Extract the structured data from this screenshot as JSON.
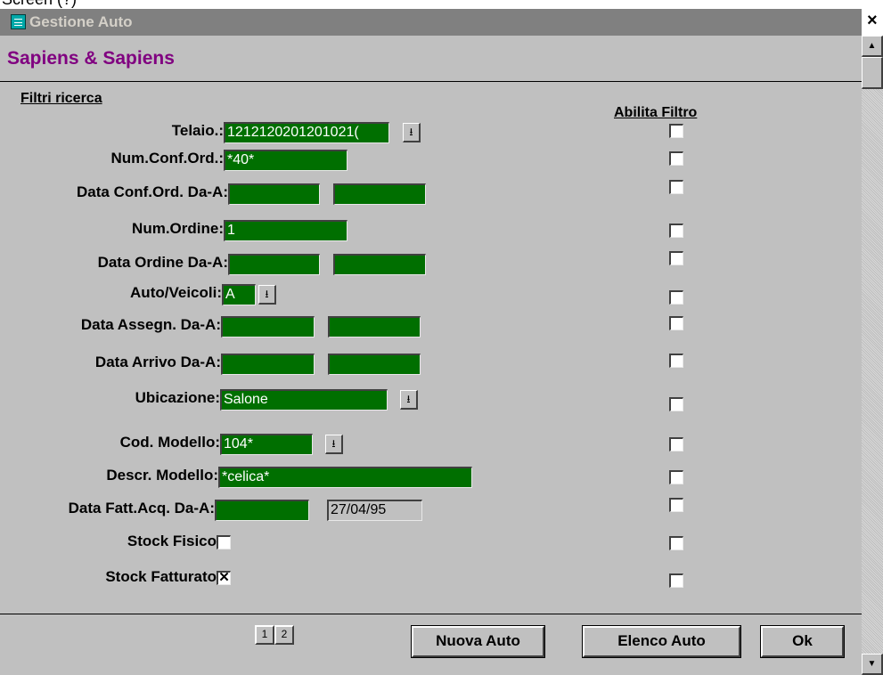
{
  "window": {
    "partial_top_text": "Screen (?)",
    "title": "Gestione Auto",
    "close_glyph": "×",
    "icon": "form-window-icon"
  },
  "header": {
    "company": "Sapiens & Sapiens"
  },
  "filters": {
    "section_label": "Filtri ricerca",
    "enable_column_label": "Abilita Filtro",
    "rows": [
      {
        "label": "Telaio.:",
        "fields": [
          "1212120201201021("
        ],
        "dropdown": true,
        "enabled": false
      },
      {
        "label": "Num.Conf.Ord.:",
        "fields": [
          "*40*"
        ],
        "enabled": false
      },
      {
        "label": "Data Conf.Ord. Da-A:",
        "fields": [
          "",
          ""
        ],
        "enabled": false
      },
      {
        "label": "Num.Ordine:",
        "fields": [
          "1"
        ],
        "enabled": false
      },
      {
        "label": "Data Ordine Da-A:",
        "fields": [
          "",
          ""
        ],
        "enabled": false
      },
      {
        "label": "Auto/Veicoli:",
        "fields": [
          "A"
        ],
        "dropdown": true,
        "enabled": false
      },
      {
        "label": "Data Assegn. Da-A:",
        "fields": [
          "",
          ""
        ],
        "enabled": false
      },
      {
        "label": "Data Arrivo Da-A:",
        "fields": [
          "",
          ""
        ],
        "enabled": false
      },
      {
        "label": "Ubicazione:",
        "fields": [
          "Salone"
        ],
        "dropdown": true,
        "enabled": false
      },
      {
        "label": "Cod. Modello:",
        "fields": [
          "104*"
        ],
        "dropdown": true,
        "enabled": false
      },
      {
        "label": "Descr. Modello:",
        "fields": [
          "*celica*"
        ],
        "enabled": false
      },
      {
        "label": "Data Fatt.Acq. Da-A:",
        "fields": [
          "",
          "27/04/95"
        ],
        "enabled": false
      },
      {
        "label": "Stock Fisico",
        "checked": false,
        "enabled": false
      },
      {
        "label": "Stock Fatturato",
        "checked": true,
        "enabled": false
      }
    ]
  },
  "footer": {
    "page_buttons": [
      "1",
      "2"
    ],
    "buttons": {
      "new": "Nuova Auto",
      "list": "Elenco Auto",
      "ok": "Ok"
    }
  },
  "scrollbar": {
    "up": "▲",
    "down": "▼"
  },
  "glyphs": {
    "dropdown": "⭳",
    "check": "✕"
  },
  "colors": {
    "field_bg": "#006f00",
    "form_bg": "#c0c0c0",
    "company": "#800080",
    "titlebar": "#808080"
  }
}
